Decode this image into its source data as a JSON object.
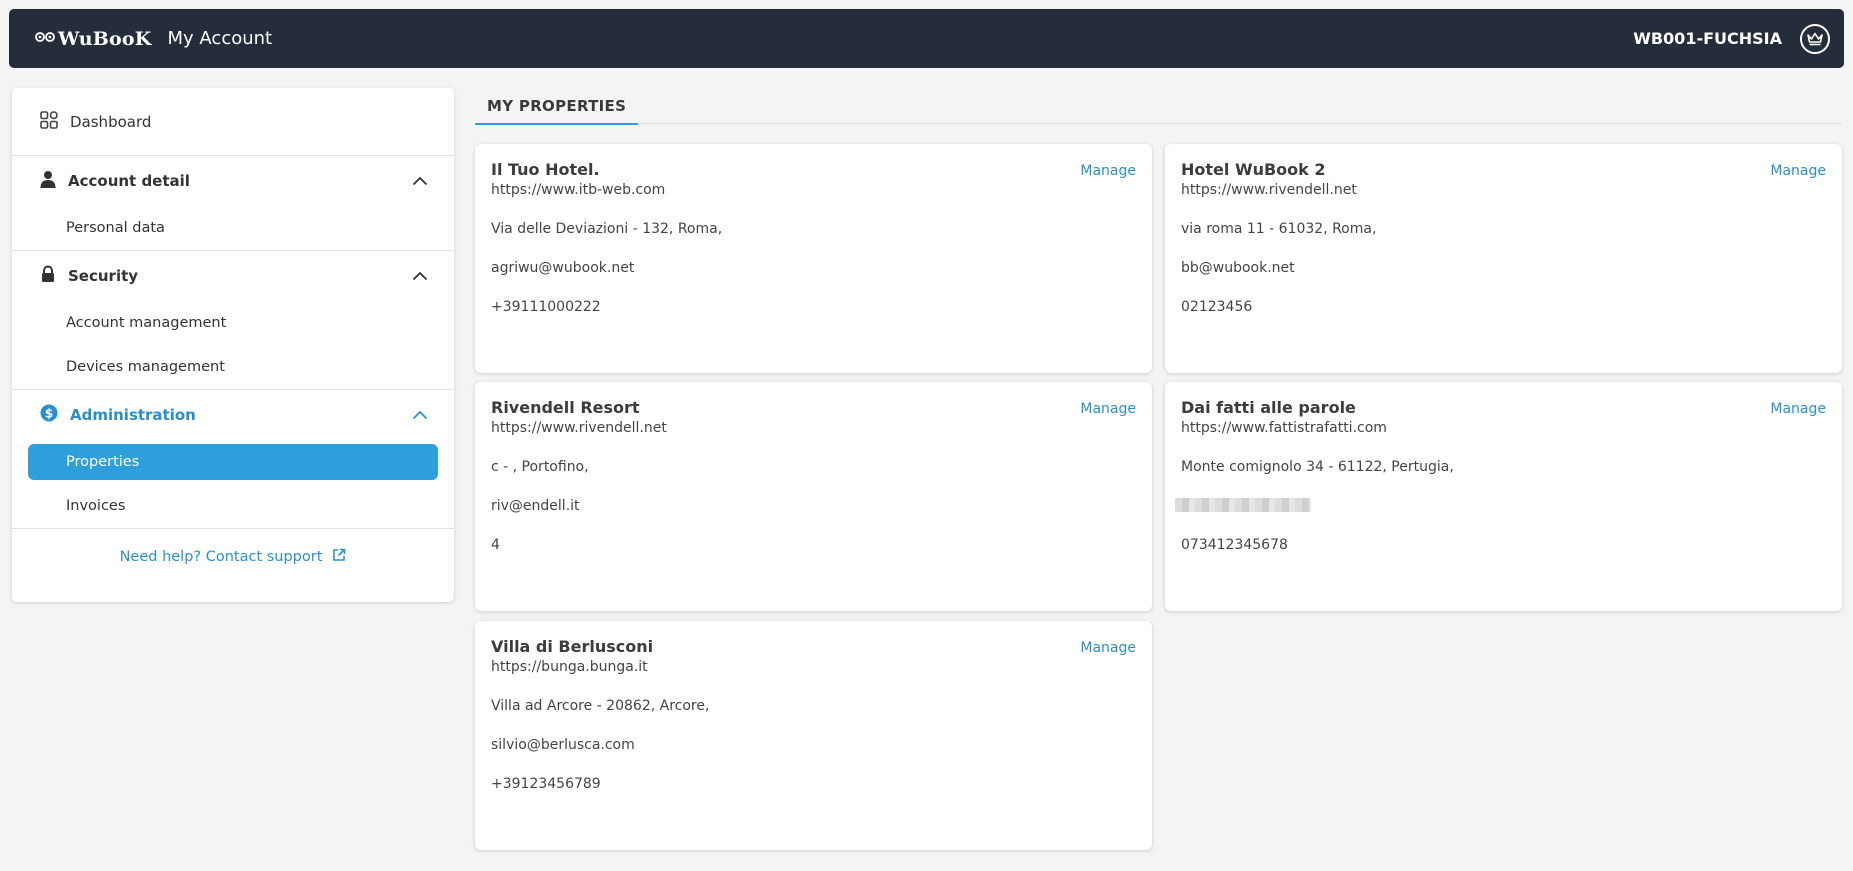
{
  "header": {
    "logo_text": "WuBooK",
    "app_title": "My Account",
    "user_code": "WB001-FUCHSIA",
    "icons": {
      "logo": "logo-icon",
      "account": "crown-icon"
    }
  },
  "sidebar": {
    "dashboard": {
      "label": "Dashboard",
      "icon": "grid-icon"
    },
    "sections": [
      {
        "label": "Account detail",
        "icon": "user-icon",
        "items": [
          "Personal data"
        ]
      },
      {
        "label": "Security",
        "icon": "lock-icon",
        "items": [
          "Account management",
          "Devices management"
        ]
      },
      {
        "label": "Administration",
        "icon": "dollar-icon",
        "items": [
          "Properties",
          "Invoices"
        ],
        "active_item": "Properties"
      }
    ],
    "support_link": "Need help? Contact support"
  },
  "main": {
    "title": "MY PROPERTIES",
    "manage_label": "Manage",
    "properties": [
      {
        "name": "Il Tuo Hotel.",
        "url": "https://www.itb-web.com",
        "address": "Via delle Deviazioni - 132, Roma,",
        "email": "agriwu@wubook.net",
        "phone": "+39111000222"
      },
      {
        "name": "Hotel WuBook 2",
        "url": "https://www.rivendell.net",
        "address": "via roma 11 - 61032, Roma,",
        "email": "bb@wubook.net",
        "phone": "02123456"
      },
      {
        "name": "Rivendell Resort",
        "url": "https://www.rivendell.net",
        "address": "c - , Portofino,",
        "email": "riv@endell.it",
        "phone": "4"
      },
      {
        "name": "Dai fatti alle parole",
        "url": "https://www.fattistrafatti.com",
        "address": "Monte comignolo 34 - 61122, Pertugia,",
        "email": "",
        "phone": "073412345678"
      },
      {
        "name": "Villa di Berlusconi",
        "url": "https://bunga.bunga.it",
        "address": "Villa ad Arcore - 20862, Arcore,",
        "email": "silvio@berlusca.com",
        "phone": "+39123456789"
      }
    ]
  }
}
